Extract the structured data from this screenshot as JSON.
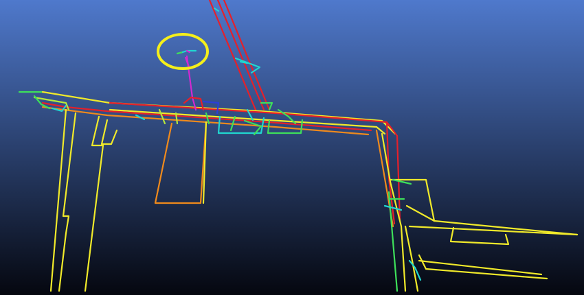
{
  "scene": {
    "background_top": "#4f79cc",
    "background_bottom": "#05070f",
    "highlight_color": "#f5ef1a",
    "palette": {
      "red": "#e5202a",
      "orange": "#f08a1c",
      "yellow": "#f1ea2a",
      "yellow_green": "#b8e83a",
      "green": "#3ee05a",
      "cyan": "#20d7d0",
      "blue": "#2a3fd8",
      "magenta": "#d12ad0"
    }
  }
}
